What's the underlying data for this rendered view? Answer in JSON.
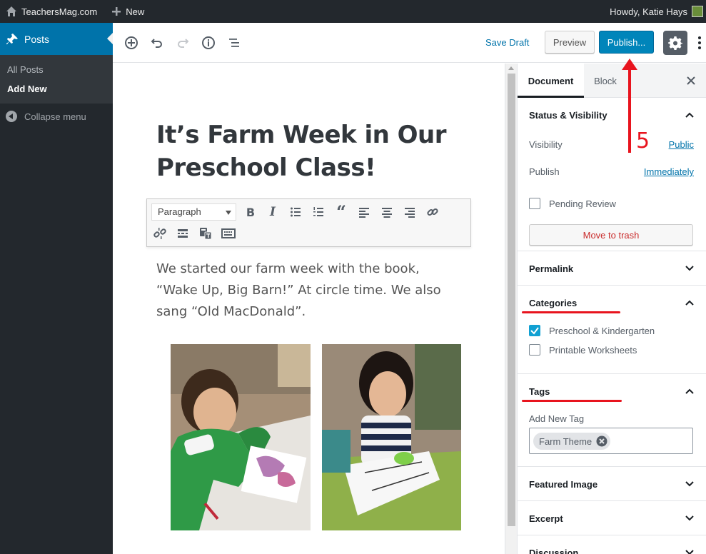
{
  "adminbar": {
    "site_name": "TeachersMag.com",
    "new_label": "New",
    "howdy": "Howdy, Katie Hays"
  },
  "sidebar": {
    "posts_label": "Posts",
    "submenu": [
      "All Posts",
      "Add New"
    ],
    "collapse_label": "Collapse menu"
  },
  "header": {
    "save_draft": "Save Draft",
    "preview": "Preview",
    "publish": "Publish..."
  },
  "post": {
    "title": "It’s Farm Week in Our Preschool Class!",
    "paragraph": "We started our farm week with the book, “Wake Up, Big Barn!” At circle time. We also sang “Old MacDonald”.",
    "format_select": "Paragraph"
  },
  "panel": {
    "tabs": [
      "Document",
      "Block"
    ],
    "status_title": "Status & Visibility",
    "visibility_label": "Visibility",
    "visibility_value": "Public",
    "publish_label": "Publish",
    "publish_value": "Immediately",
    "pending_review": "Pending Review",
    "move_to_trash": "Move to trash",
    "permalink_title": "Permalink",
    "categories_title": "Categories",
    "categories": [
      {
        "label": "Preschool & Kindergarten",
        "checked": true
      },
      {
        "label": "Printable Worksheets",
        "checked": false
      }
    ],
    "tags_title": "Tags",
    "add_new_tag": "Add New Tag",
    "tags": [
      "Farm Theme"
    ],
    "featured_image_title": "Featured Image",
    "excerpt_title": "Excerpt",
    "discussion_title": "Discussion"
  },
  "annotation": {
    "step_number": "5",
    "color": "#e8141e"
  },
  "colors": {
    "admin_dark": "#23282d",
    "wp_blue": "#0073aa",
    "publish_blue": "#0085ba"
  }
}
